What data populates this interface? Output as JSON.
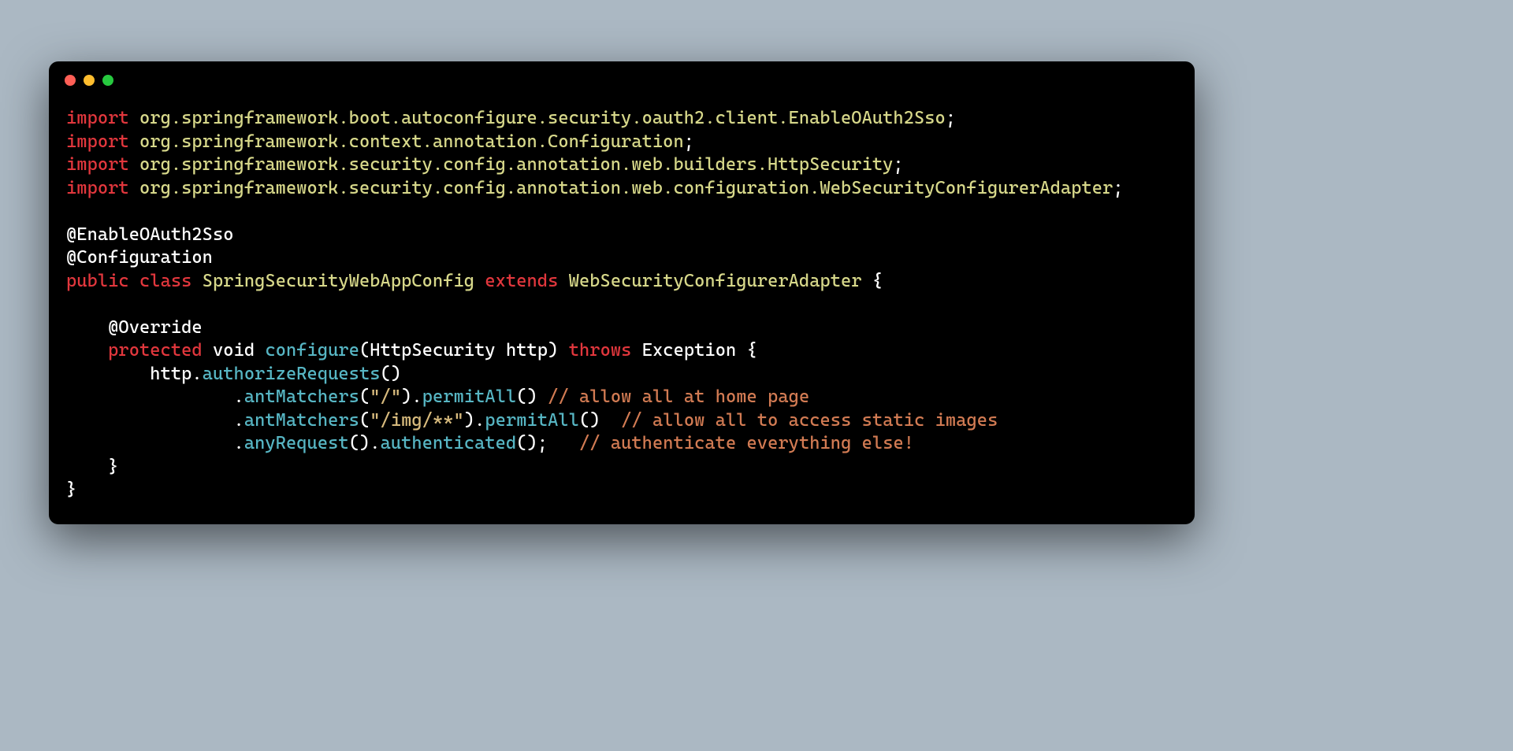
{
  "colors": {
    "close": "#ff5f56",
    "min": "#ffbd2e",
    "max": "#27c93f"
  },
  "kw": {
    "import": "import",
    "public": "public",
    "class": "class",
    "extends": "extends",
    "protected": "protected",
    "throws": "throws"
  },
  "space": " ",
  "imports": {
    "l1": "org.springframework.boot.autoconfigure.security.oauth2.client.EnableOAuth2Sso",
    "l2": "org.springframework.context.annotation.Configuration",
    "l3": "org.springframework.security.config.annotation.web.builders.HttpSecurity",
    "l4": "org.springframework.security.config.annotation.web.configuration.WebSecurityConfigurerAdapter"
  },
  "semi": ";",
  "ann": {
    "enable": "@EnableOAuth2Sso",
    "config": "@Configuration",
    "override": "@Override"
  },
  "cls": {
    "name": "SpringSecurityWebAppConfig",
    "base": "WebSecurityConfigurerAdapter",
    "openBrace": " {"
  },
  "method": {
    "ret": "void",
    "name": "configure",
    "paren_open": "(",
    "argType": "HttpSecurity",
    "argName": " http",
    "paren_close": ")",
    "exception": "Exception",
    "brace": " {"
  },
  "body": {
    "httpDot": "http.",
    "authReq": "authorizeRequests",
    "paren": "()",
    "dot": ".",
    "antMatchers": "antMatchers",
    "permitAll": "permitAll",
    "anyRequest": "anyRequest",
    "authenticated": "authenticated",
    "openP": "(",
    "closeP": ")",
    "strRoot": "\"/\"",
    "strImg": "\"/img/**\"",
    "c1": "// allow all at home page",
    "c2": "// allow all to access static images",
    "c3": "// authenticate everything else!",
    "closeInner": "    }",
    "closeOuter": "}"
  },
  "indent": {
    "i1": "    ",
    "i2": "        ",
    "i4": "                "
  }
}
